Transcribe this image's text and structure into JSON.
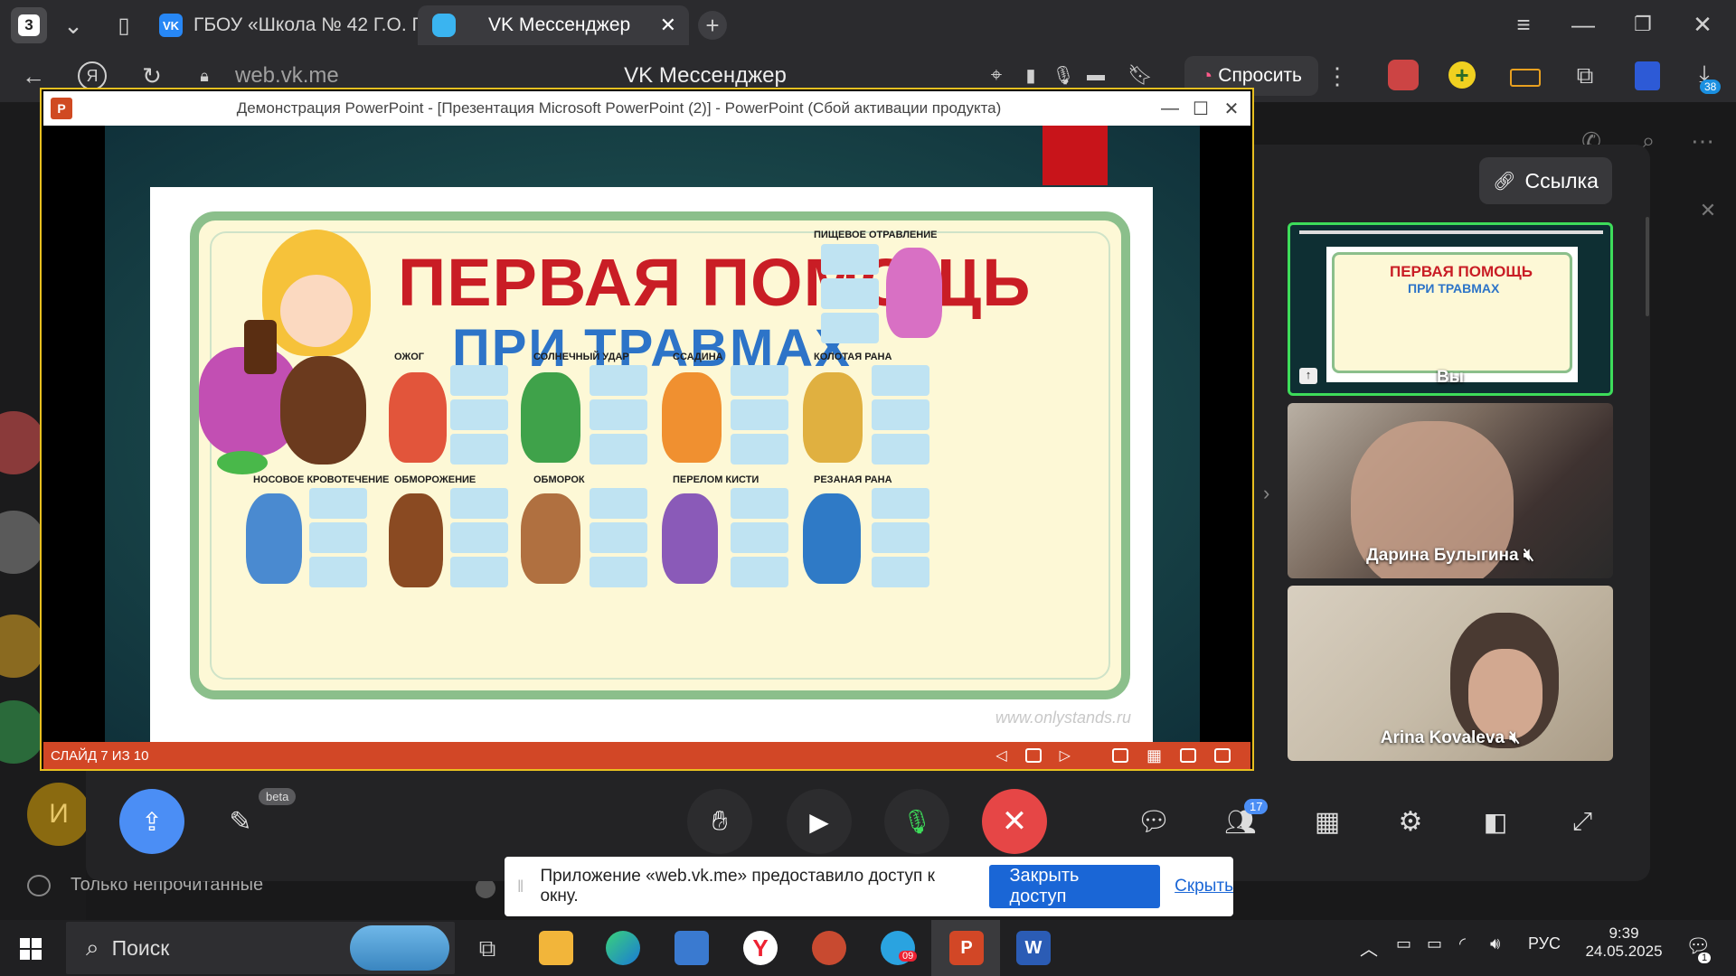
{
  "browser": {
    "tab_count": "3",
    "tabs": [
      {
        "label": "ГБОУ «Школа № 42 Г.О. Г"
      },
      {
        "label": "VK Мессенджер"
      }
    ],
    "url": "web.vk.me",
    "page_title": "VK Мессенджер",
    "ask_label": "Спросить",
    "downloads_badge": "38"
  },
  "powerpoint": {
    "window_title": "Демонстрация PowerPoint - [Презентация Microsoft PowerPoint (2)] - PowerPoint (Сбой активации продукта)",
    "status": "СЛАЙД 7 ИЗ 10",
    "slide": {
      "title_line1": "ПЕРВАЯ ПОМОЩЬ",
      "title_line2": "ПРИ ТРАВМАХ",
      "cells": [
        {
          "label": "ПИЩЕВОЕ ОТРАВЛЕНИЕ"
        },
        {
          "label": "ОЖОГ"
        },
        {
          "label": "СОЛНЕЧНЫЙ УДАР"
        },
        {
          "label": "ССАДИНА"
        },
        {
          "label": "КОЛОТАЯ РАНА"
        },
        {
          "label": "НОСОВОЕ КРОВОТЕЧЕНИЕ"
        },
        {
          "label": "ОБМОРОЖЕНИЕ"
        },
        {
          "label": "ОБМОРОК"
        },
        {
          "label": "ПЕРЕЛОМ КИСТИ"
        },
        {
          "label": "РЕЗАНАЯ РАНА"
        }
      ],
      "watermark": "www.onlystands.ru"
    }
  },
  "call": {
    "link_label": "Ссылка",
    "participants": [
      {
        "name": "Вы"
      },
      {
        "name": "Дарина Булыгина"
      },
      {
        "name": "Arina Kovaleva"
      }
    ],
    "beta_badge": "beta",
    "participants_count": "17",
    "unread_filter": "Только непрочитанные",
    "sidebar_avatar_letter": "И"
  },
  "share_notice": {
    "text": "Приложение «web.vk.me» предоставило доступ к окну.",
    "close_access": "Закрыть доступ",
    "hide": "Скрыть"
  },
  "taskbar": {
    "search_label": "Поиск",
    "lang": "РУС",
    "time": "9:39",
    "date": "24.05.2025",
    "notification_count": "1",
    "telegram_badge": "09"
  },
  "colors": {
    "ppt_accent": "#d24726",
    "poster_red": "#c91d25",
    "poster_blue": "#2d74c8",
    "vk_blue": "#2787f5",
    "end_call_red": "#e64646",
    "active_speaker": "#3ddc5a"
  }
}
